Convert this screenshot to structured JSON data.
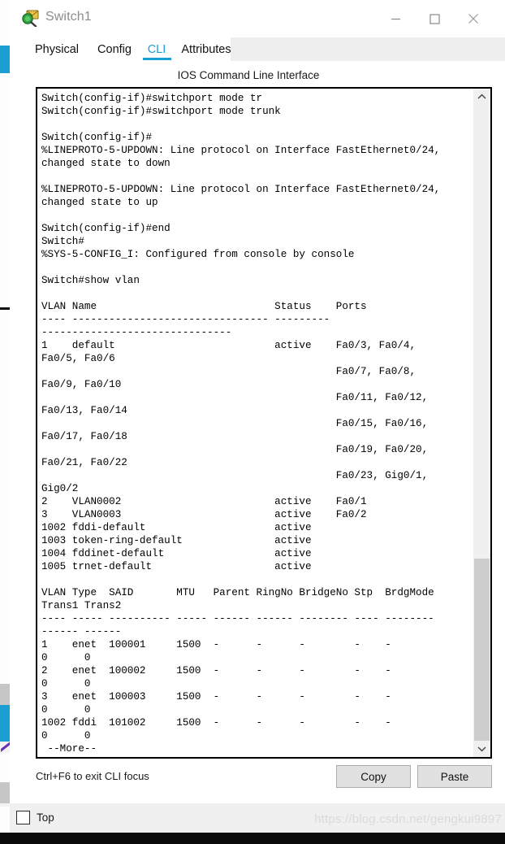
{
  "window": {
    "title": "Switch1",
    "icon": "packet-tracer-envelope-icon",
    "minimize_label": "—",
    "maximize_label": "□",
    "close_label": "✕"
  },
  "tabs": [
    {
      "label": "Physical",
      "active": false
    },
    {
      "label": "Config",
      "active": false
    },
    {
      "label": "CLI",
      "active": true
    },
    {
      "label": "Attributes",
      "active": false
    }
  ],
  "panel": {
    "title": "IOS Command Line Interface"
  },
  "terminal": {
    "lines": [
      "Switch(config-if)#switchport mode tr",
      "Switch(config-if)#switchport mode trunk",
      "",
      "Switch(config-if)#",
      "%LINEPROTO-5-UPDOWN: Line protocol on Interface FastEthernet0/24,",
      "changed state to down",
      "",
      "%LINEPROTO-5-UPDOWN: Line protocol on Interface FastEthernet0/24,",
      "changed state to up",
      "",
      "Switch(config-if)#end",
      "Switch#",
      "%SYS-5-CONFIG_I: Configured from console by console",
      "",
      "Switch#show vlan",
      "",
      "VLAN Name                             Status    Ports",
      "---- -------------------------------- ---------",
      "-------------------------------",
      "1    default                          active    Fa0/3, Fa0/4,",
      "Fa0/5, Fa0/6",
      "                                                Fa0/7, Fa0/8,",
      "Fa0/9, Fa0/10",
      "                                                Fa0/11, Fa0/12,",
      "Fa0/13, Fa0/14",
      "                                                Fa0/15, Fa0/16,",
      "Fa0/17, Fa0/18",
      "                                                Fa0/19, Fa0/20,",
      "Fa0/21, Fa0/22",
      "                                                Fa0/23, Gig0/1,",
      "Gig0/2",
      "2    VLAN0002                         active    Fa0/1",
      "3    VLAN0003                         active    Fa0/2",
      "1002 fddi-default                     active",
      "1003 token-ring-default               active",
      "1004 fddinet-default                  active",
      "1005 trnet-default                    active",
      "",
      "VLAN Type  SAID       MTU   Parent RingNo BridgeNo Stp  BrdgMode",
      "Trans1 Trans2",
      "---- ----- ---------- ----- ------ ------ -------- ---- --------",
      "------ ------",
      "1    enet  100001     1500  -      -      -        -    -",
      "0      0",
      "2    enet  100002     1500  -      -      -        -    -",
      "0      0",
      "3    enet  100003     1500  -      -      -        -    -",
      "0      0",
      "1002 fddi  101002     1500  -      -      -        -    -",
      "0      0",
      " --More--"
    ]
  },
  "scrollbar": {
    "up_arrow": "chevron-up",
    "down_arrow": "chevron-down"
  },
  "footer": {
    "hint": "Ctrl+F6 to exit CLI focus",
    "copy_label": "Copy",
    "paste_label": "Paste"
  },
  "bottom": {
    "top_checkbox_label": "Top",
    "top_checked": false,
    "watermark": "https://blog.csdn.net/gengkui9897"
  },
  "colors": {
    "accent": "#1a9fd4",
    "window_bg": "#ffffff",
    "panel_bg": "#f0f0f0",
    "button_face": "#e1e1e1",
    "scrollbar_thumb": "#cdcdcd"
  }
}
